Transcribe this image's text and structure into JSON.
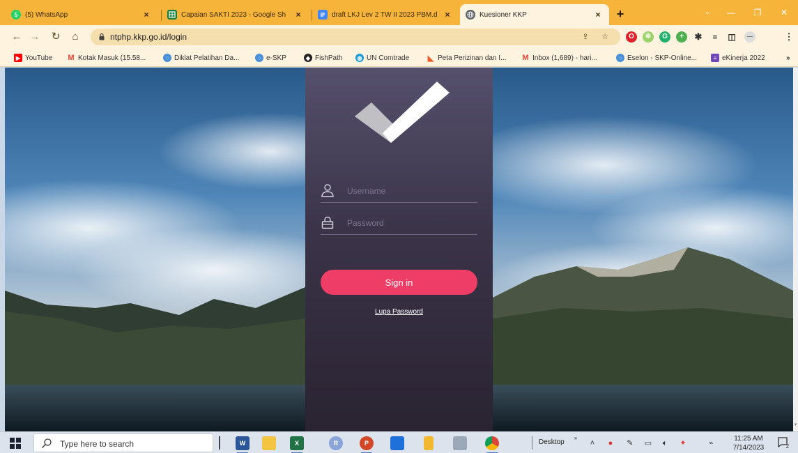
{
  "browser": {
    "tabs": [
      {
        "title": "(5) WhatsApp",
        "icon": "whatsapp-icon",
        "badge": "5",
        "color": "#25d366",
        "active": false
      },
      {
        "title": "Capaian SAKTI 2023 - Google Sh",
        "icon": "google-sheets-icon",
        "color": "#188038",
        "active": false
      },
      {
        "title": "draft LKJ Lev 2 TW II 2023 PBM.d",
        "icon": "google-docs-icon",
        "color": "#4285f4",
        "active": false
      },
      {
        "title": "Kuesioner KKP",
        "icon": "globe-icon",
        "color": "#5f6368",
        "active": true
      }
    ],
    "new_tab_label": "+",
    "url": "ntphp.kkp.go.id/login",
    "bookmarks": [
      {
        "label": "YouTube",
        "icon": "youtube-icon",
        "color": "#ff0000"
      },
      {
        "label": "Kotak Masuk (15.58...",
        "icon": "gmail-icon",
        "color": "#ea4335"
      },
      {
        "label": "Diklat Pelatihan Da...",
        "icon": "globe-icon",
        "color": "#4a90d9"
      },
      {
        "label": "e-SKP",
        "icon": "globe-icon",
        "color": "#4a90d9"
      },
      {
        "label": "FishPath",
        "icon": "fishpath-icon",
        "color": "#222222"
      },
      {
        "label": "UN Comtrade",
        "icon": "un-comtrade-icon",
        "color": "#1a9bd7"
      },
      {
        "label": "Peta Perizinan dan I...",
        "icon": "peta-icon",
        "color": "#f05a28"
      },
      {
        "label": "Inbox (1,689) - hari...",
        "icon": "gmail-icon",
        "color": "#ea4335"
      },
      {
        "label": "Eselon - SKP-Online...",
        "icon": "globe-icon",
        "color": "#4a90d9"
      },
      {
        "label": "eKinerja 2022",
        "icon": "google-forms-icon",
        "color": "#7248b9"
      }
    ],
    "bookmarks_more": "»"
  },
  "login": {
    "username_placeholder": "Username",
    "password_placeholder": "Password",
    "signin_label": "Sign in",
    "forgot_label": "Lupa Password",
    "accent_color": "#ee3e67"
  },
  "taskbar": {
    "search_placeholder": "Type here to search",
    "desktop_label": "Desktop",
    "desktop_superscript": "»",
    "apps": [
      {
        "name": "word-icon",
        "label": "W",
        "color": "#2b579a",
        "running": true
      },
      {
        "name": "file-explorer-icon",
        "label": "",
        "color": "#f4c542",
        "running": false
      },
      {
        "name": "excel-icon",
        "label": "X",
        "color": "#217346",
        "running": true
      },
      {
        "name": "app-r-icon",
        "label": "R",
        "color": "#8aa3d9",
        "running": false
      },
      {
        "name": "powerpoint-icon",
        "label": "P",
        "color": "#d24726",
        "running": true
      },
      {
        "name": "vpn-shield-icon",
        "label": "",
        "color": "#1e6fd9",
        "running": false
      },
      {
        "name": "folder-icon",
        "label": "",
        "color": "#f2b830",
        "running": false
      },
      {
        "name": "calculator-icon",
        "label": "",
        "color": "#9aa8b8",
        "running": false
      },
      {
        "name": "chrome-icon",
        "label": "",
        "color": "#db4437",
        "running": true
      }
    ],
    "time": "11:25 AM",
    "date": "7/14/2023",
    "notification_count": "2"
  }
}
